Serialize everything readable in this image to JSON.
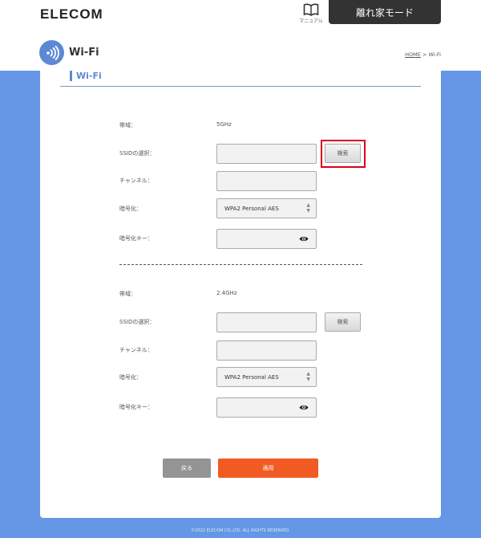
{
  "header": {
    "logo": "ELECOM",
    "manual_label": "マニュアル",
    "mode_button": "離れ家モード"
  },
  "page": {
    "title": "Wi-Fi",
    "breadcrumb_home": "HOME",
    "breadcrumb_sep": " > ",
    "breadcrumb_current": "Wi-Fi",
    "section_title": "Wi-Fi"
  },
  "band5": {
    "band_label": "帯域：",
    "band_value": "5GHz",
    "ssid_label": "SSIDの選択：",
    "ssid_value": "",
    "search_button": "検索",
    "channel_label": "チャンネル：",
    "channel_value": "",
    "encryption_label": "暗号化：",
    "encryption_value": "WPA2 Personal AES",
    "key_label": "暗号化キー：",
    "key_value": ""
  },
  "band24": {
    "band_label": "帯域：",
    "band_value": "2.4GHz",
    "ssid_label": "SSIDの選択：",
    "ssid_value": "",
    "search_button": "検索",
    "channel_label": "チャンネル：",
    "channel_value": "",
    "encryption_label": "暗号化：",
    "encryption_value": "WPA2 Personal AES",
    "key_label": "暗号化キー：",
    "key_value": ""
  },
  "actions": {
    "back": "戻る",
    "apply": "適用"
  },
  "footer": {
    "copyright": "©2022 ELECOM CO.,LTD. ALL RIGHTS RESERVED."
  },
  "colors": {
    "accent_blue": "#6597e6",
    "apply_orange": "#f15a22",
    "highlight_red": "#d9001b"
  }
}
